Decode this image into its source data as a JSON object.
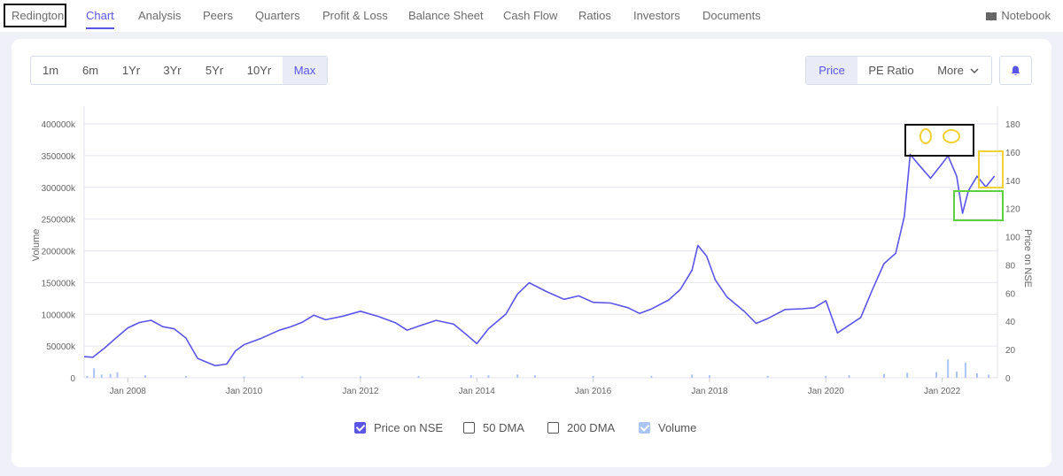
{
  "nav": {
    "brand": "Redington",
    "items": [
      "Chart",
      "Analysis",
      "Peers",
      "Quarters",
      "Profit & Loss",
      "Balance Sheet",
      "Cash Flow",
      "Ratios",
      "Investors",
      "Documents"
    ],
    "active": "Chart",
    "notebook": "Notebook"
  },
  "ranges": {
    "items": [
      "1m",
      "6m",
      "1Yr",
      "3Yr",
      "5Yr",
      "10Yr",
      "Max"
    ],
    "active": "Max"
  },
  "modes": {
    "price": "Price",
    "pe": "PE Ratio",
    "more": "More",
    "active": "Price"
  },
  "legend": {
    "price": "Price on NSE",
    "dma50": "50 DMA",
    "dma200": "200 DMA",
    "volume": "Volume"
  },
  "colors": {
    "accent": "#5b55e8",
    "price_line": "#5b55e8",
    "volume": "#aac4f4",
    "annot_black": "#111111",
    "annot_yellow": "#f2d135",
    "annot_green": "#5dd13f"
  },
  "chart_data": {
    "type": "line",
    "left_axis": {
      "label": "Volume",
      "ticks": [
        "0",
        "50000k",
        "100000k",
        "150000k",
        "200000k",
        "250000k",
        "300000k",
        "350000k",
        "400000k"
      ],
      "range": [
        0,
        400000000
      ]
    },
    "right_axis": {
      "label": "Price on NSE",
      "ticks": [
        "0",
        "20",
        "40",
        "60",
        "80",
        "100",
        "120",
        "140",
        "160",
        "180"
      ],
      "range": [
        0,
        180
      ]
    },
    "x_ticks": [
      "Jan 2008",
      "Jan 2010",
      "Jan 2012",
      "Jan 2014",
      "Jan 2016",
      "Jan 2018",
      "Jan 2020",
      "Jan 2022"
    ],
    "x_range": [
      2007.25,
      2022.95
    ],
    "series": [
      {
        "name": "Price on NSE",
        "points": [
          [
            2007.25,
            15
          ],
          [
            2007.4,
            14
          ],
          [
            2007.6,
            20
          ],
          [
            2007.8,
            27
          ],
          [
            2008.0,
            34
          ],
          [
            2008.2,
            38
          ],
          [
            2008.4,
            40
          ],
          [
            2008.6,
            36
          ],
          [
            2008.8,
            35
          ],
          [
            2009.0,
            29
          ],
          [
            2009.2,
            15
          ],
          [
            2009.5,
            10
          ],
          [
            2009.7,
            11
          ],
          [
            2009.85,
            20
          ],
          [
            2010.0,
            24
          ],
          [
            2010.3,
            28
          ],
          [
            2010.6,
            33
          ],
          [
            2010.8,
            35
          ],
          [
            2011.0,
            38
          ],
          [
            2011.2,
            43
          ],
          [
            2011.4,
            40
          ],
          [
            2011.7,
            43
          ],
          [
            2012.0,
            47
          ],
          [
            2012.3,
            44
          ],
          [
            2012.6,
            40
          ],
          [
            2012.8,
            35
          ],
          [
            2013.0,
            38
          ],
          [
            2013.3,
            42
          ],
          [
            2013.6,
            39
          ],
          [
            2013.85,
            30
          ],
          [
            2014.0,
            24
          ],
          [
            2014.2,
            34
          ],
          [
            2014.5,
            44
          ],
          [
            2014.7,
            58
          ],
          [
            2014.9,
            66
          ],
          [
            2015.2,
            60
          ],
          [
            2015.5,
            55
          ],
          [
            2015.75,
            58
          ],
          [
            2016.0,
            54
          ],
          [
            2016.3,
            54
          ],
          [
            2016.6,
            51
          ],
          [
            2016.8,
            47
          ],
          [
            2017.0,
            50
          ],
          [
            2017.3,
            56
          ],
          [
            2017.5,
            63
          ],
          [
            2017.7,
            76
          ],
          [
            2017.8,
            93
          ],
          [
            2017.95,
            85
          ],
          [
            2018.1,
            68
          ],
          [
            2018.3,
            56
          ],
          [
            2018.6,
            46
          ],
          [
            2018.8,
            38
          ],
          [
            2019.0,
            42
          ],
          [
            2019.3,
            49
          ],
          [
            2019.6,
            50
          ],
          [
            2019.8,
            51
          ],
          [
            2020.0,
            56
          ],
          [
            2020.2,
            33
          ],
          [
            2020.4,
            38
          ],
          [
            2020.6,
            43
          ],
          [
            2020.8,
            62
          ],
          [
            2021.0,
            80
          ],
          [
            2021.2,
            87
          ],
          [
            2021.35,
            113
          ],
          [
            2021.45,
            157
          ],
          [
            2021.6,
            150
          ],
          [
            2021.8,
            141
          ],
          [
            2022.0,
            152
          ],
          [
            2022.1,
            158
          ],
          [
            2022.25,
            144
          ],
          [
            2022.35,
            118
          ],
          [
            2022.45,
            134
          ],
          [
            2022.6,
            144
          ],
          [
            2022.75,
            136
          ],
          [
            2022.9,
            143
          ]
        ]
      },
      {
        "name": "Volume",
        "points": [
          [
            2007.3,
            3000000
          ],
          [
            2007.42,
            15000000
          ],
          [
            2007.55,
            5000000
          ],
          [
            2007.7,
            6000000
          ],
          [
            2007.82,
            9000000
          ],
          [
            2008.3,
            4000000
          ],
          [
            2009.0,
            3000000
          ],
          [
            2010.0,
            2000000
          ],
          [
            2011.0,
            2000000
          ],
          [
            2012.0,
            2000000
          ],
          [
            2013.0,
            3000000
          ],
          [
            2013.9,
            4000000
          ],
          [
            2014.2,
            4000000
          ],
          [
            2014.7,
            5000000
          ],
          [
            2015.0,
            4000000
          ],
          [
            2016.0,
            3000000
          ],
          [
            2017.0,
            3000000
          ],
          [
            2017.7,
            5000000
          ],
          [
            2018.0,
            4000000
          ],
          [
            2019.0,
            3000000
          ],
          [
            2020.0,
            3000000
          ],
          [
            2020.4,
            4000000
          ],
          [
            2021.0,
            6000000
          ],
          [
            2021.4,
            8000000
          ],
          [
            2021.9,
            9000000
          ],
          [
            2022.1,
            29000000
          ],
          [
            2022.25,
            10000000
          ],
          [
            2022.4,
            24000000
          ],
          [
            2022.6,
            7000000
          ],
          [
            2022.8,
            5000000
          ]
        ]
      }
    ],
    "grid": true,
    "legend_position": "bottom"
  }
}
